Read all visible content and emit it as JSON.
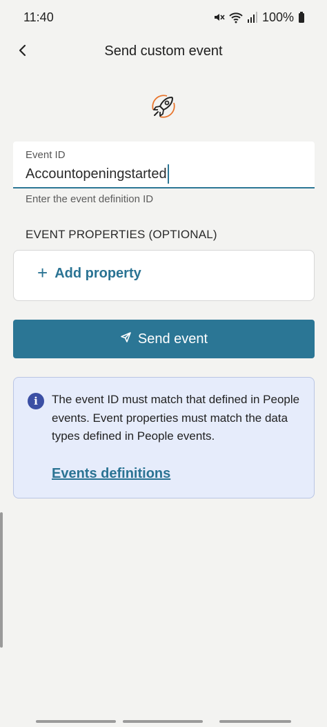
{
  "status_bar": {
    "time": "11:40",
    "battery": "100%",
    "icons": [
      "mute-icon",
      "wifi-icon",
      "signal-icon",
      "battery-icon"
    ]
  },
  "app_bar": {
    "title": "Send custom event",
    "back_icon": "chevron-left-icon"
  },
  "hero_icon": "rocket-icon",
  "event_id_field": {
    "label": "Event ID",
    "value": "Accountopeningstarted",
    "helper": "Enter the event definition ID"
  },
  "properties_section": {
    "label": "EVENT PROPERTIES (OPTIONAL)",
    "add_label": "Add property"
  },
  "send_button": {
    "label": "Send event",
    "icon": "send-icon"
  },
  "info": {
    "icon": "info-icon",
    "text": "The event ID must match that defined in People events. Event properties must match the data types defined in People events.",
    "link": "Events definitions"
  },
  "colors": {
    "accent": "#2b7695",
    "background": "#f3f3f1",
    "info_bg": "#e6ecfb",
    "info_icon": "#3b4fa4"
  }
}
